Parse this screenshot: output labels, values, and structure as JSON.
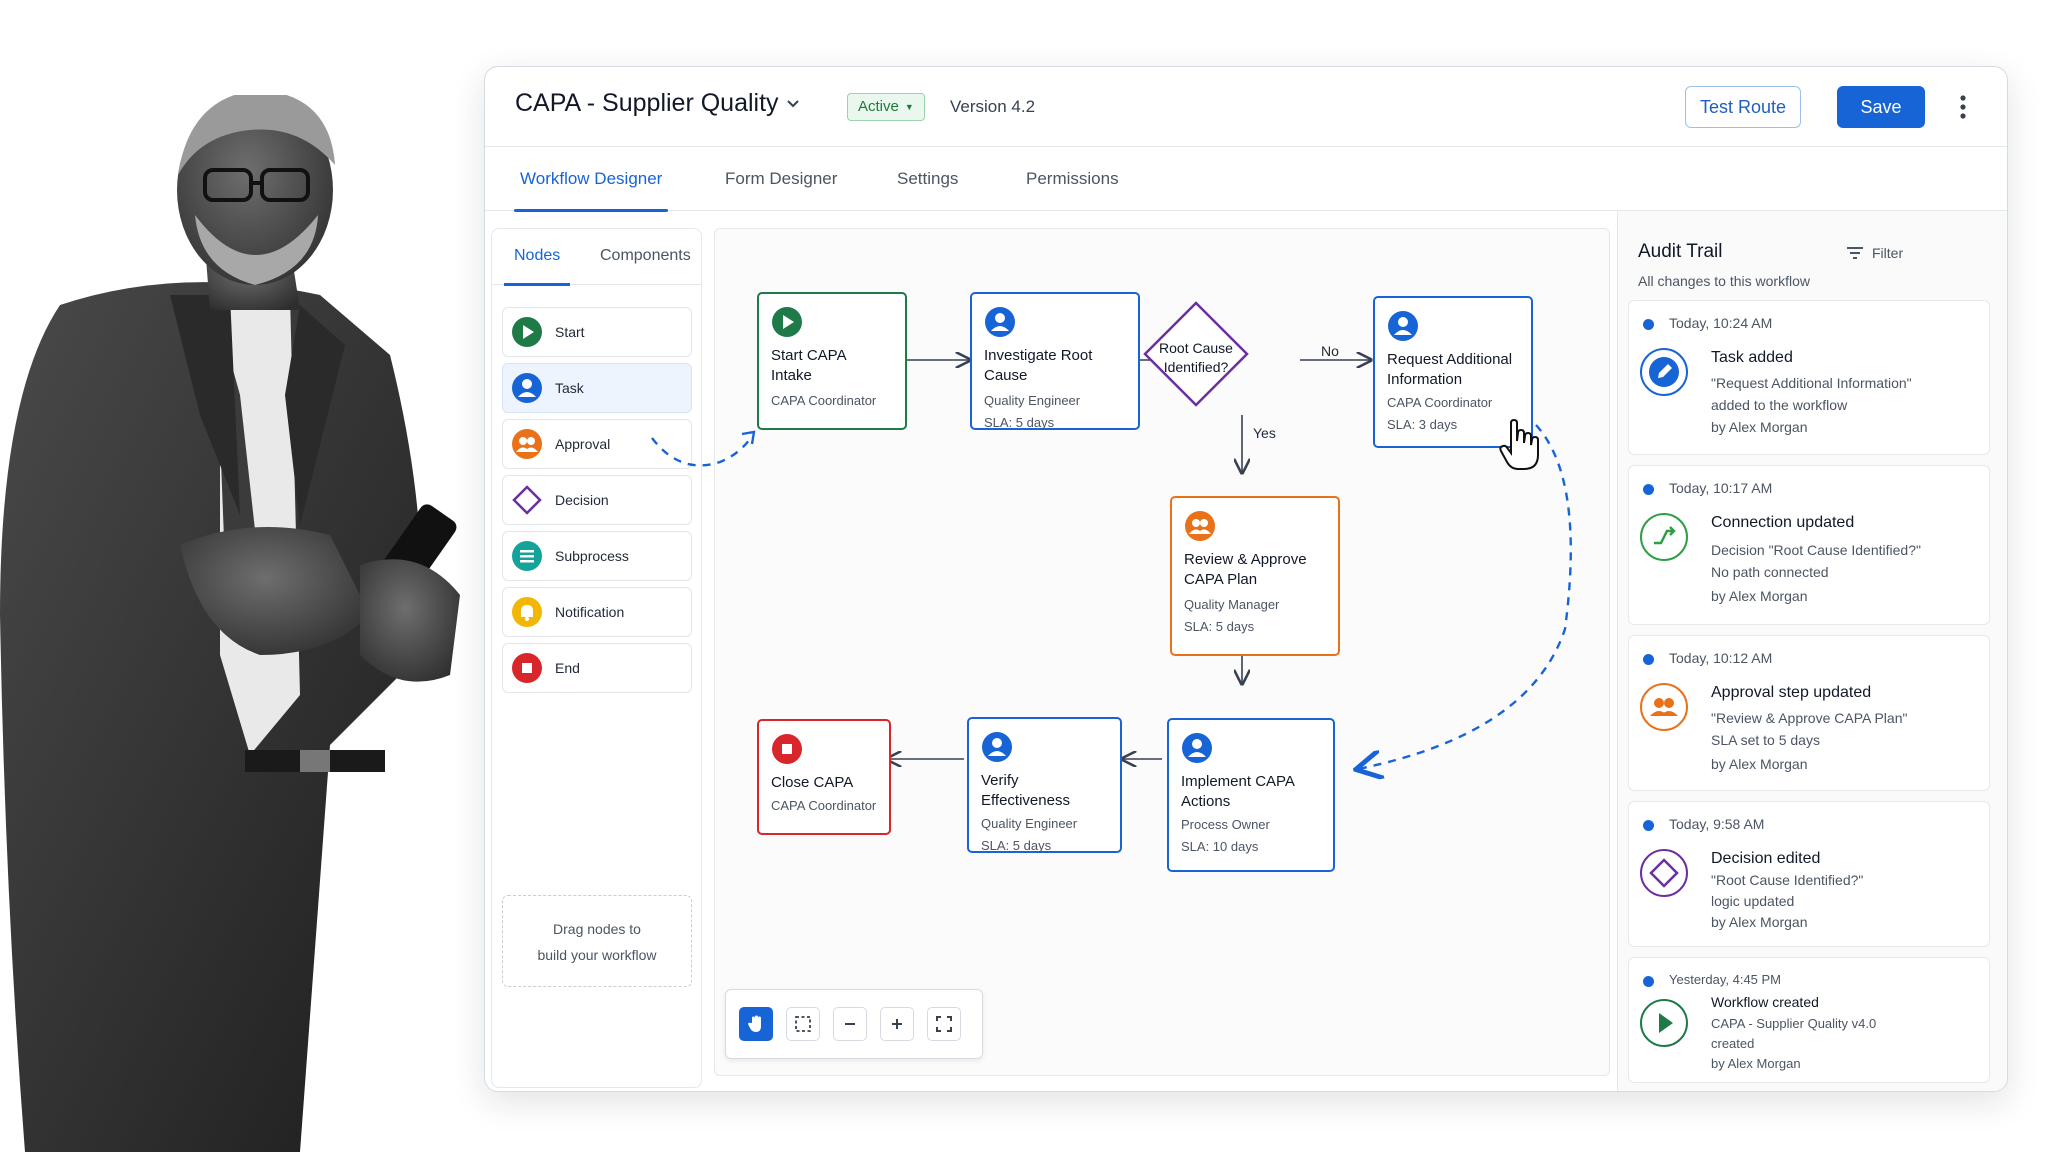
{
  "header": {
    "title": "CAPA - Supplier Quality",
    "status": "Active",
    "version": "Version 4.2",
    "test_route_label": "Test Route",
    "save_label": "Save"
  },
  "tabs": [
    {
      "label": "Workflow Designer",
      "active": true
    },
    {
      "label": "Form Designer",
      "active": false
    },
    {
      "label": "Settings",
      "active": false
    },
    {
      "label": "Permissions",
      "active": false
    }
  ],
  "palette": {
    "tabs": [
      {
        "label": "Nodes",
        "active": true
      },
      {
        "label": "Components",
        "active": false
      }
    ],
    "items": [
      {
        "label": "Start",
        "icon": "play-icon",
        "color": "#1e7a47"
      },
      {
        "label": "Task",
        "icon": "user-icon",
        "color": "#1764d6",
        "selected": true
      },
      {
        "label": "Approval",
        "icon": "users-icon",
        "color": "#e8711a"
      },
      {
        "label": "Decision",
        "icon": "diamond-icon",
        "color": "#6b2fa0"
      },
      {
        "label": "Subprocess",
        "icon": "list-icon",
        "color": "#14a39a"
      },
      {
        "label": "Notification",
        "icon": "bell-icon",
        "color": "#f2b705"
      },
      {
        "label": "End",
        "icon": "stop-icon",
        "color": "#d8262b"
      }
    ],
    "drop_hint_line1": "Drag nodes to",
    "drop_hint_line2": "build your workflow"
  },
  "flow": {
    "start": {
      "title1": "Start CAPA",
      "title2": "Intake",
      "role": "CAPA Coordinator"
    },
    "investigate": {
      "title": "Investigate Root Cause",
      "role": "Quality Engineer",
      "sla": "SLA: 5 days"
    },
    "decision": {
      "line1": "Root Cause",
      "line2": "Identified?",
      "no_label": "No",
      "yes_label": "Yes"
    },
    "request": {
      "title1": "Request Additional",
      "title2": "Information",
      "role": "CAPA Coordinator",
      "sla": "SLA: 3 days"
    },
    "review": {
      "title1": "Review & Approve",
      "title2": "CAPA Plan",
      "role": "Quality Manager",
      "sla": "SLA: 5 days"
    },
    "implement": {
      "title1": "Implement CAPA",
      "title2": "Actions",
      "role": "Process Owner",
      "sla": "SLA: 10 days"
    },
    "verify": {
      "title": "Verify Effectiveness",
      "role": "Quality Engineer",
      "sla": "SLA: 5 days"
    },
    "close": {
      "title": "Close CAPA",
      "role": "CAPA Coordinator"
    }
  },
  "audit": {
    "title": "Audit Trail",
    "subtitle": "All changes to this workflow",
    "filter_label": "Filter",
    "entries": [
      {
        "time": "Today, 10:24 AM",
        "title": "Task added",
        "lines": [
          "\"Request Additional Information\"",
          "added to the workflow",
          "by Alex Morgan"
        ],
        "icon": "pencil-icon",
        "color": "#1764d6"
      },
      {
        "time": "Today, 10:17 AM",
        "title": "Connection updated",
        "lines": [
          "Decision \"Root Cause Identified?\"",
          "No path connected",
          "by Alex Morgan"
        ],
        "icon": "connection-icon",
        "color": "#2f9e44"
      },
      {
        "time": "Today, 10:12 AM",
        "title": "Approval step updated",
        "lines": [
          "\"Review & Approve CAPA Plan\"",
          "SLA set to 5 days",
          "by Alex Morgan"
        ],
        "icon": "users-icon",
        "color": "#e8711a"
      },
      {
        "time": "Today, 9:58 AM",
        "title": "Decision edited",
        "lines": [
          "\"Root Cause Identified?\"",
          "logic updated",
          "by Alex Morgan"
        ],
        "icon": "diamond-icon",
        "color": "#6b2fa0"
      },
      {
        "time": "Yesterday, 4:45 PM",
        "title": "Workflow created",
        "lines": [
          "CAPA - Supplier Quality v4.0",
          "created",
          "by Alex Morgan"
        ],
        "icon": "play-icon",
        "color": "#1e7a47"
      }
    ]
  },
  "colors": {
    "accent": "#1764d6",
    "start": "#1e7a47",
    "approval": "#e8711a",
    "decision": "#6b2fa0",
    "end": "#d8262b"
  }
}
